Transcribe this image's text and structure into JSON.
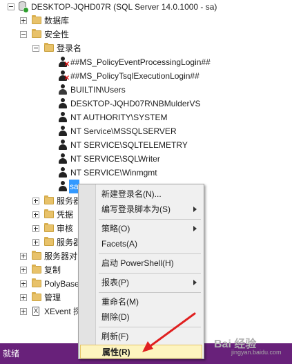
{
  "tree": {
    "server": "DESKTOP-JQHD07R (SQL Server 14.0.1000 - sa)",
    "databases": "数据库",
    "security": "安全性",
    "logins": "登录名",
    "login_items": [
      "##MS_PolicyEventProcessingLogin##",
      "##MS_PolicyTsqlExecutionLogin##",
      "BUILTIN\\Users",
      "DESKTOP-JQHD07R\\NBMulderVS",
      "NT AUTHORITY\\SYSTEM",
      "NT Service\\MSSQLSERVER",
      "NT SERVICE\\SQLTELEMETRY",
      "NT SERVICE\\SQLWriter",
      "NT SERVICE\\Winmgmt",
      "sa"
    ],
    "sec_sub": [
      "服务器",
      "凭据",
      "审核",
      "服务器"
    ],
    "top_items": [
      "服务器对",
      "复制",
      "PolyBase",
      "管理",
      "XEvent 探"
    ]
  },
  "context_menu": {
    "items": [
      "新建登录名(N)...",
      "编写登录脚本为(S)",
      "策略(O)",
      "Facets(A)",
      "启动 PowerShell(H)",
      "报表(P)",
      "重命名(M)",
      "删除(D)",
      "刷新(F)",
      "属性(R)"
    ]
  },
  "status_bar": {
    "text": "就绪"
  },
  "watermark": {
    "brand": "Bai 经验",
    "url": "jingyan.baidu.com"
  },
  "colors": {
    "status_bg": "#68217a",
    "selection": "#3399ff",
    "menu_hover": "#fdf4bf",
    "annotation_arrow": "#e02020"
  }
}
